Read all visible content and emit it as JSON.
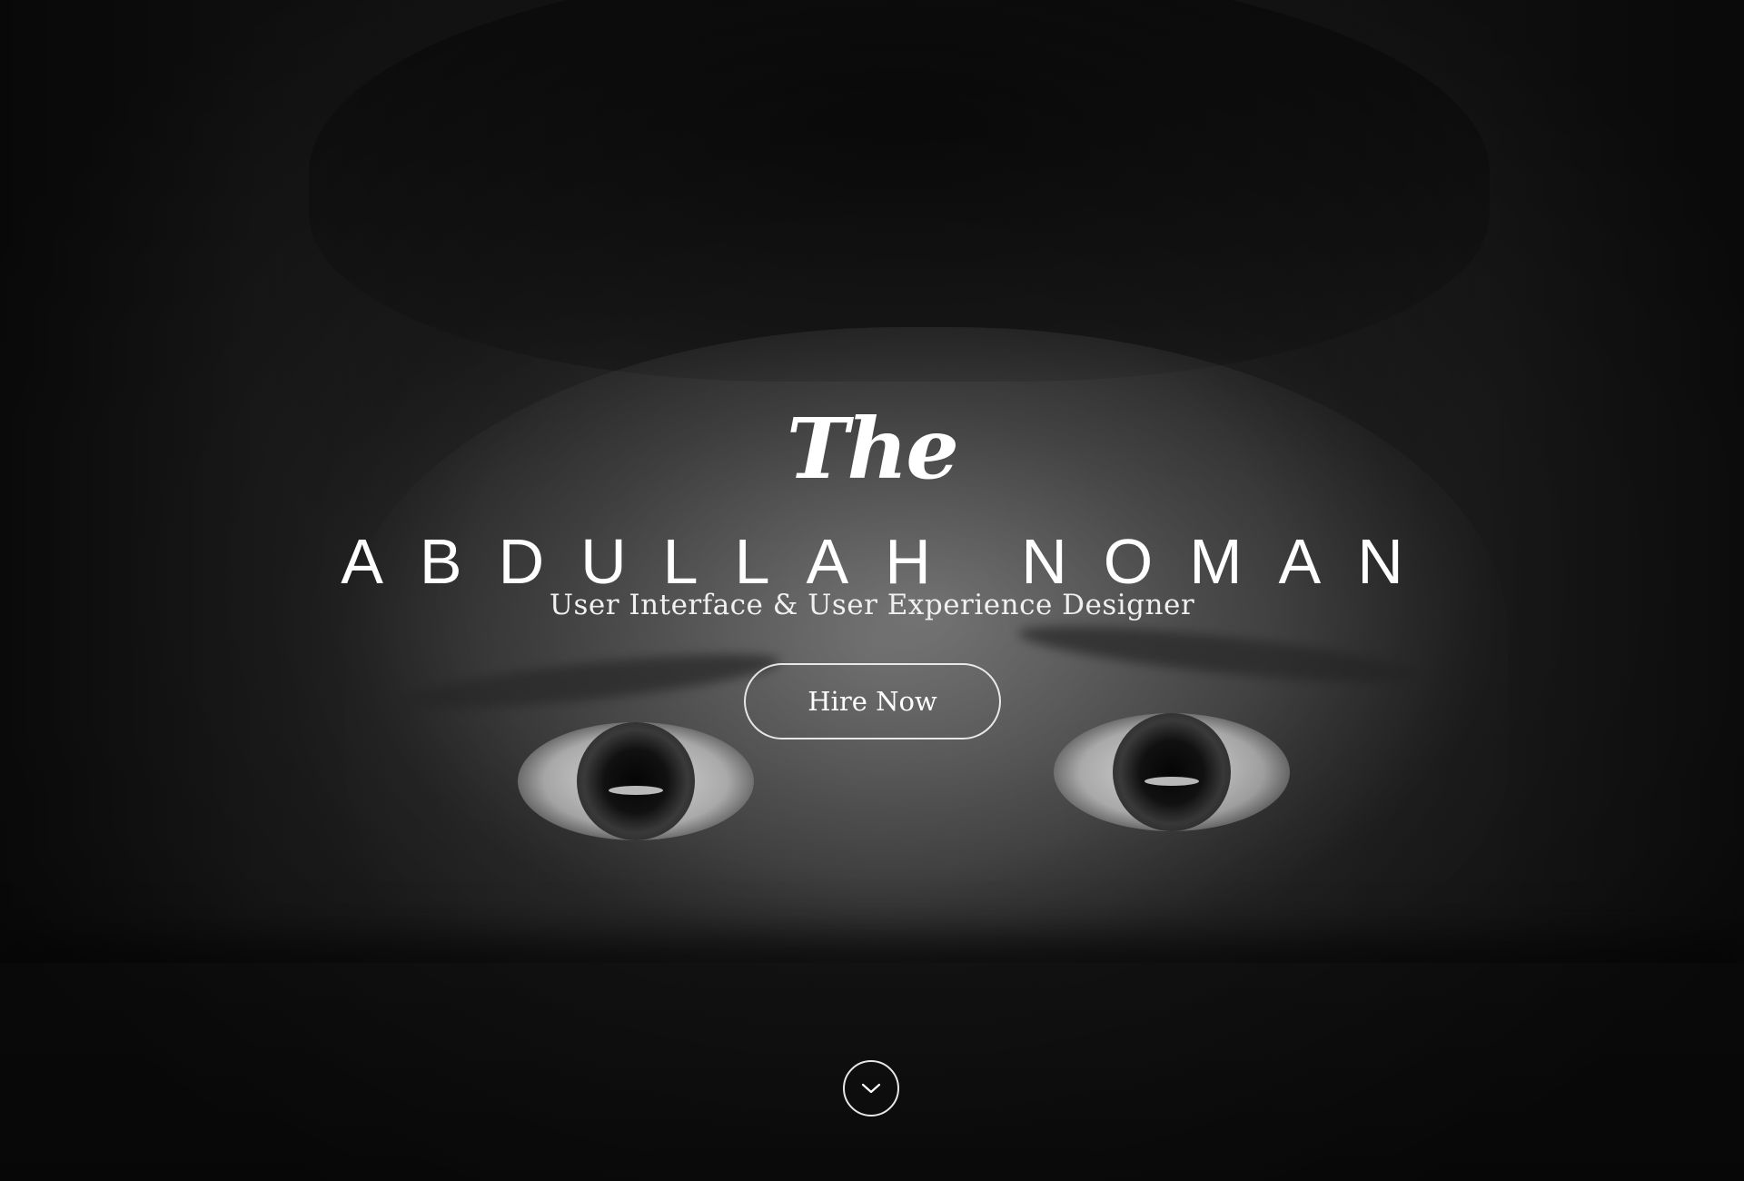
{
  "hero": {
    "script_title": "The",
    "name": "ABDULLAH NOMAN",
    "subtitle": "User Interface & User Experience Designer",
    "cta_label": "Hire Now",
    "scroll_icon": "chevron-down-icon"
  },
  "colors": {
    "text": "#ffffff",
    "background": "#161616"
  }
}
